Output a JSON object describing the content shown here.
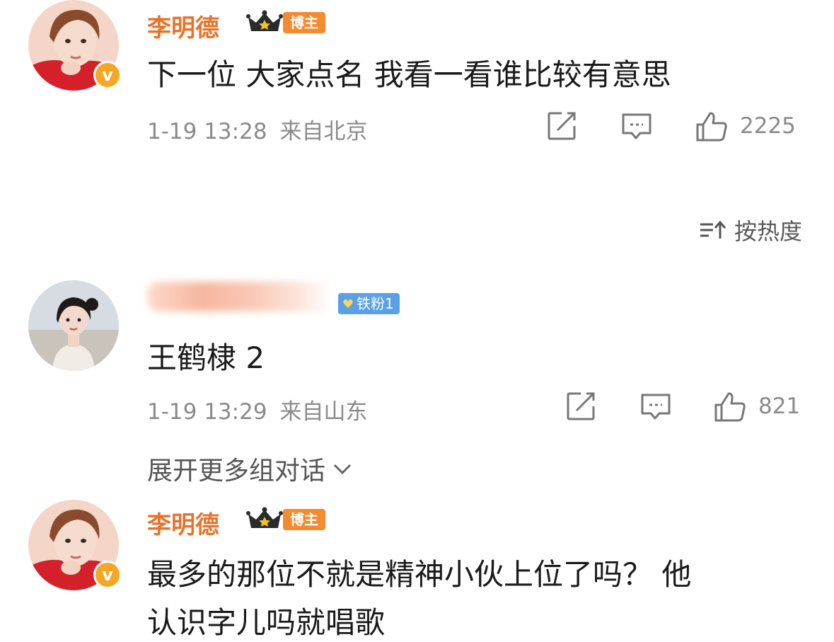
{
  "comments": [
    {
      "username": "李明德",
      "badge": "博主",
      "text": "下一位 大家点名 我看一看谁比较有意思",
      "time": "1-19 13:28",
      "location": "来自北京",
      "likes": "2225"
    },
    {
      "fan_badge": "铁粉1",
      "text": "王鹤棣 2",
      "time": "1-19 13:29",
      "location": "来自山东",
      "likes": "821"
    },
    {
      "username": "李明德",
      "badge": "博主",
      "text_line1": "最多的那位不就是精神小伙上位了吗？ 他",
      "text_line2": "认识字儿吗就唱歌"
    }
  ],
  "sort": {
    "label": "按热度"
  },
  "expand": {
    "label": "展开更多组对话"
  },
  "verified_mark": "v",
  "colors": {
    "username": "#e8722a",
    "badge": "#f58a2e",
    "fan_badge": "#5aa0e6",
    "verified": "#f5a623"
  }
}
